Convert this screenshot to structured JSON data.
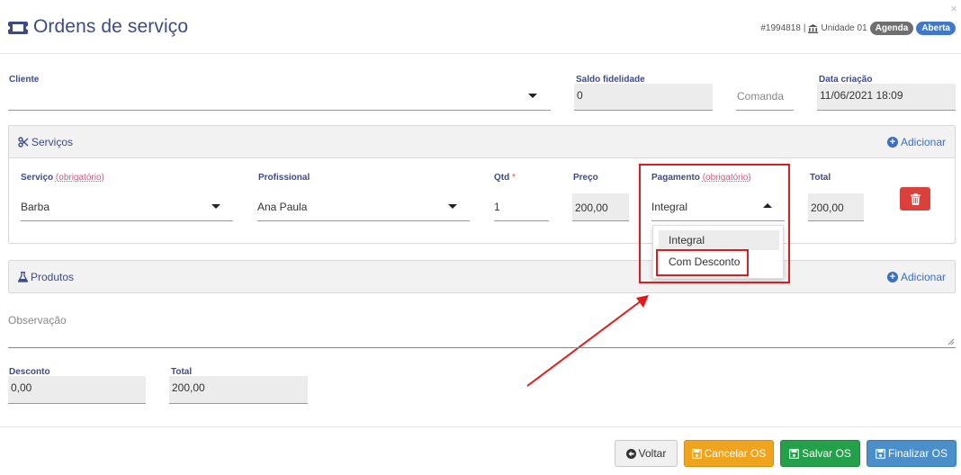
{
  "header": {
    "title": "Ordens de serviço",
    "order_number": "#1994818",
    "separator": "|",
    "unit": "Unidade 01",
    "badge_agenda": "Agenda",
    "badge_aberta": "Aberta",
    "close": "×"
  },
  "top_fields": {
    "cliente_label": "Cliente",
    "cliente_value": "",
    "saldo_label": "Saldo fidelidade",
    "saldo_value": "0",
    "comanda_placeholder": "Comanda",
    "data_label": "Data criação",
    "data_value": "11/06/2021 18:09"
  },
  "servicos": {
    "title": "Serviços",
    "add_label": "Adicionar",
    "columns": {
      "servico": "Serviço",
      "servico_req": "(obrigatório)",
      "profissional": "Profissional",
      "qtd": "Qtd",
      "qtd_star": "*",
      "preco": "Preço",
      "pagamento": "Pagamento",
      "pagamento_req": "(obrigatório)",
      "total": "Total"
    },
    "row": {
      "servico": "Barba",
      "profissional": "Ana Paula",
      "qtd": "1",
      "preco": "200,00",
      "pagamento": "Integral",
      "total": "200,00"
    },
    "pagamento_options": [
      "Integral",
      "Com Desconto"
    ]
  },
  "produtos": {
    "title": "Produtos",
    "add_label": "Adicionar"
  },
  "observacao": {
    "placeholder": "Observação"
  },
  "totals": {
    "desconto_label": "Desconto",
    "desconto_value": "0,00",
    "total_label": "Total",
    "total_value": "200,00"
  },
  "footer": {
    "voltar": "Voltar",
    "cancelar": "Cancelar OS",
    "salvar": "Salvar OS",
    "finalizar": "Finalizar OS"
  },
  "colors": {
    "accent": "#3d4a8a",
    "annotation": "#e01b1b",
    "danger": "#d9413a",
    "warning": "#f0a41e",
    "success": "#24a04b",
    "primary": "#4a8fc9"
  }
}
